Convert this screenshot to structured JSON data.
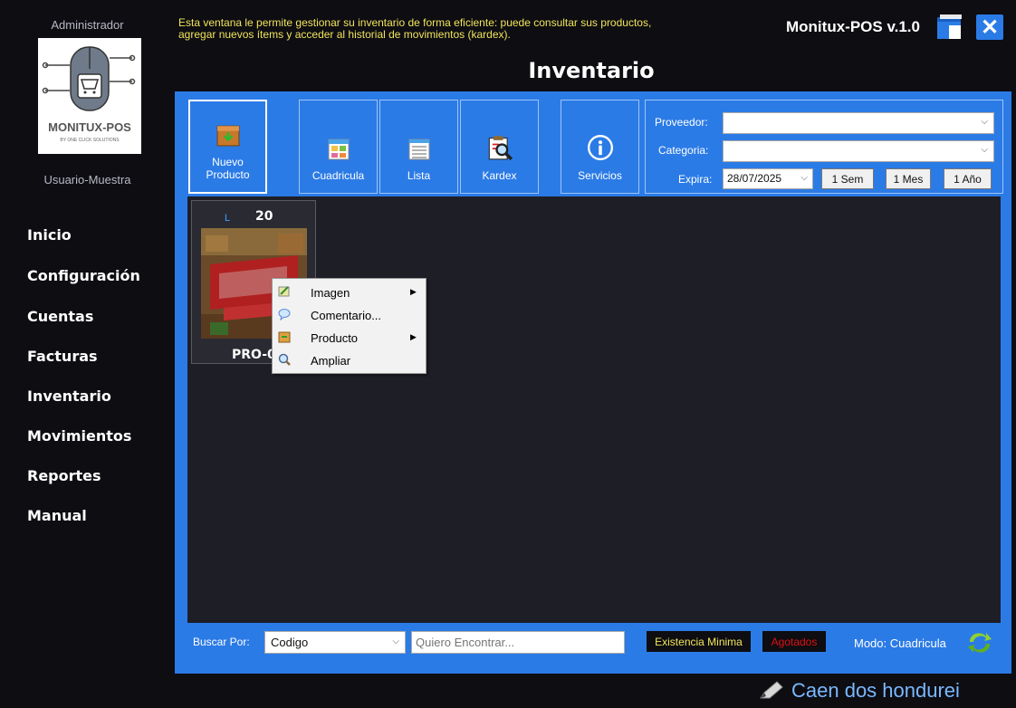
{
  "sidebar": {
    "role_label": "Administrador",
    "logo_text": "MONITUX-POS",
    "logo_sub": "BY ONE CLICK SOLUTIONS",
    "user_label": "Usuario-Muestra",
    "nav": [
      {
        "label": "Inicio"
      },
      {
        "label": "Configuración"
      },
      {
        "label": "Cuentas"
      },
      {
        "label": "Facturas"
      },
      {
        "label": "Inventario"
      },
      {
        "label": "Movimientos"
      },
      {
        "label": "Reportes"
      },
      {
        "label": "Manual"
      }
    ]
  },
  "header": {
    "description_line1": "Esta ventana le permite gestionar su inventario de forma eficiente: puede consultar sus productos,",
    "description_line2": "agregar nuevos ítems y acceder al historial de movimientos (kardex).",
    "app_title": "Monitux-POS v.1.0",
    "page_title": "Inventario"
  },
  "toolbar": {
    "new_product_line1": "Nuevo",
    "new_product_line2": "Producto",
    "grid": "Cuadricula",
    "list": "Lista",
    "kardex": "Kardex",
    "services": "Servicios"
  },
  "filters": {
    "supplier_label": "Proveedor:",
    "supplier_value": "",
    "category_label": "Categoria:",
    "category_value": "",
    "expires_label": "Expira:",
    "expires_value": "28/07/2025",
    "range_week": "1 Sem",
    "range_month": "1 Mes",
    "range_year": "1 Año"
  },
  "products": [
    {
      "stock_tag": "L",
      "quantity": "20",
      "code": "PRO-0"
    }
  ],
  "context_menu": {
    "items": [
      {
        "label": "Imagen",
        "submenu": true
      },
      {
        "label": "Comentario...",
        "submenu": false
      },
      {
        "label": "Producto",
        "submenu": true
      },
      {
        "label": "Ampliar",
        "submenu": false
      }
    ]
  },
  "search": {
    "label": "Buscar Por:",
    "field_value": "Codigo",
    "placeholder": "Quiero Encontrar...",
    "min_stock": "Existencia Minima",
    "out_of_stock": "Agotados",
    "mode": "Modo: Cuadricula"
  },
  "toast": {
    "text": "Caen dos hondurei"
  },
  "colors": {
    "panel_blue": "#2b7be6",
    "background": "#0d0d12",
    "grid_background": "#1e1e27",
    "description_yellow": "#f2e45a",
    "out_of_stock_red": "#e01010",
    "toast_blue": "#7ab8ff"
  }
}
